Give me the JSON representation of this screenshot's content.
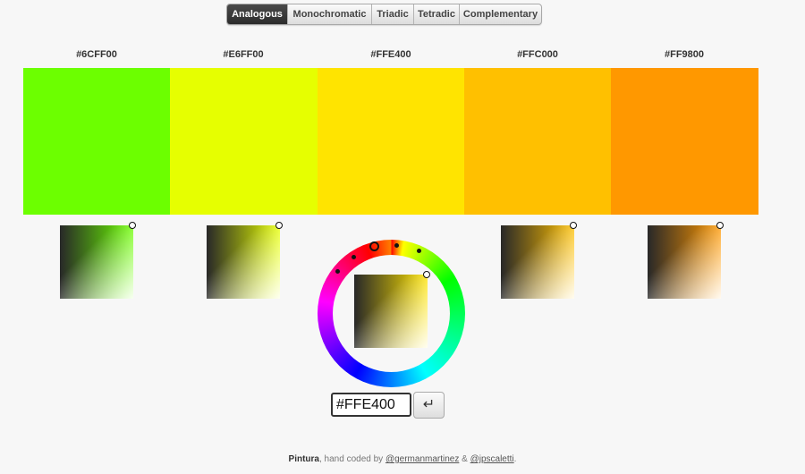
{
  "tabs": [
    {
      "label": "Analogous",
      "active": true
    },
    {
      "label": "Monochromatic",
      "active": false
    },
    {
      "label": "Triadic",
      "active": false
    },
    {
      "label": "Tetradic",
      "active": false
    },
    {
      "label": "Complementary",
      "active": false
    }
  ],
  "colors": [
    {
      "hex": "#6CFF00"
    },
    {
      "hex": "#E6FF00"
    },
    {
      "hex": "#FFE400"
    },
    {
      "hex": "#FFC000"
    },
    {
      "hex": "#FF9800"
    }
  ],
  "hex_input": {
    "value": "#FFE400"
  },
  "enter_button": {
    "label": "↵"
  },
  "footer": {
    "brand": "Pintura",
    "text1": ", hand coded by ",
    "author1": "@germanmartinez",
    "text2": " & ",
    "author2": "@jpscaletti",
    "text3": "."
  },
  "icons": {
    "enter": "return-arrow-icon"
  }
}
